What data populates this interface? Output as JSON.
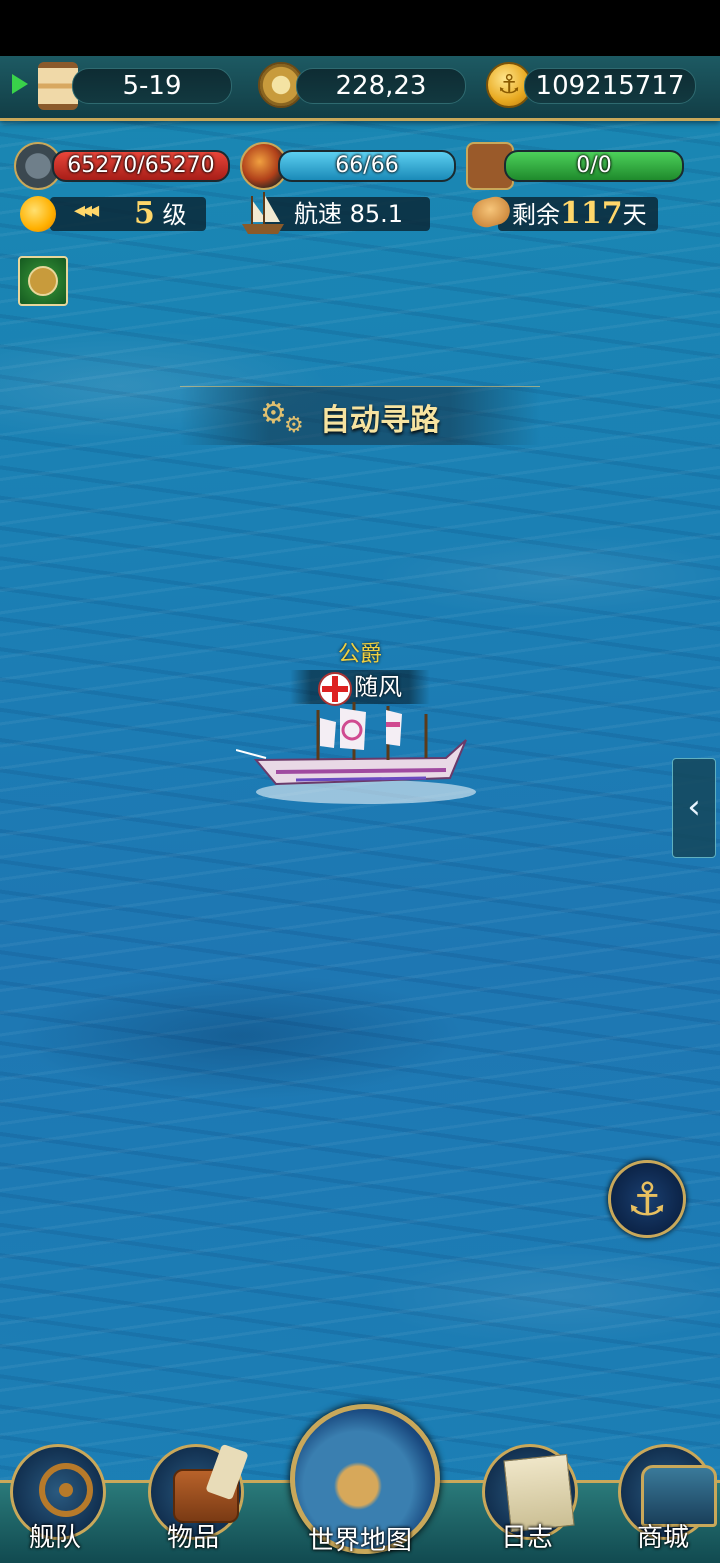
{
  "top_bar": {
    "date": "5-19",
    "coordinates": "228,23",
    "gold": "109215717"
  },
  "stats": {
    "durability": "65270/65270",
    "durability_fill": 1.0,
    "crew": "66/66",
    "crew_fill": 1.0,
    "cargo": "0/0",
    "cargo_fill": 1.0
  },
  "info": {
    "level_number": "5",
    "level_suffix": "级",
    "speed_label": "航速",
    "speed_value": "85.1",
    "remaining_prefix": "剩余",
    "remaining_days": "117",
    "remaining_suffix": "天"
  },
  "auto_path": {
    "label": "自动寻路"
  },
  "player_ship": {
    "rank": "公爵",
    "name": "随风"
  },
  "bottom_menu": {
    "fleet": "舰队",
    "items": "物品",
    "world_map": "世界地图",
    "log": "日志",
    "shop": "商城"
  },
  "icons": {
    "play": "play-icon",
    "hourglass": "hourglass-icon",
    "compass": "compass-icon",
    "anchor_coin": "anchor-coin-icon",
    "hammer": "hammer-icon",
    "crew": "crew-icon",
    "crate": "crate-icon",
    "sun": "sun-icon",
    "ship": "ship-icon",
    "bread": "bread-icon",
    "gear": "gear-icon",
    "anchor": "anchor-icon",
    "chevron": "chevron-left-icon"
  },
  "colors": {
    "durability": "#d8332a",
    "crew": "#34b6e0",
    "cargo": "#34b84a",
    "accent_gold": "#c9a85a"
  }
}
